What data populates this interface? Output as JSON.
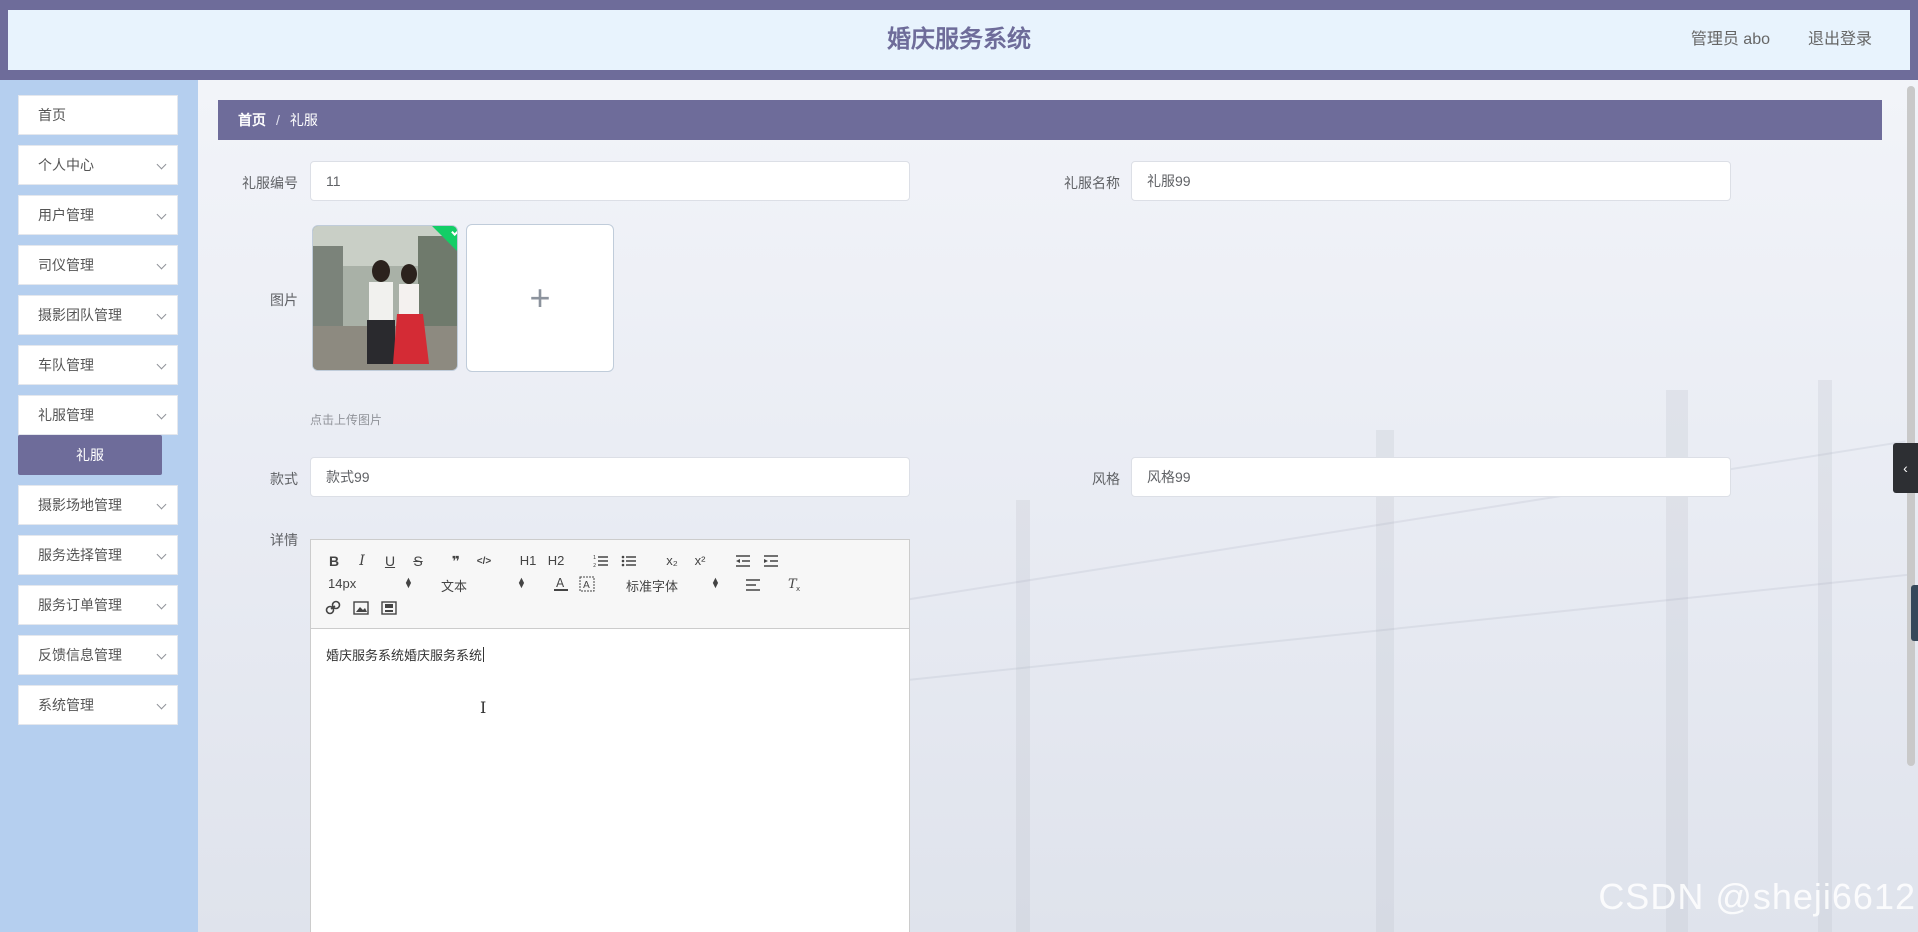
{
  "header": {
    "title": "婚庆服务系统",
    "user": "管理员 abo",
    "logout": "退出登录"
  },
  "sidebar": {
    "items": [
      {
        "label": "首页"
      },
      {
        "label": "个人中心"
      },
      {
        "label": "用户管理"
      },
      {
        "label": "司仪管理"
      },
      {
        "label": "摄影团队管理"
      },
      {
        "label": "车队管理"
      },
      {
        "label": "礼服管理"
      },
      {
        "label": "摄影场地管理"
      },
      {
        "label": "服务选择管理"
      },
      {
        "label": "服务订单管理"
      },
      {
        "label": "反馈信息管理"
      },
      {
        "label": "系统管理"
      }
    ],
    "active_sub": "礼服"
  },
  "breadcrumb": {
    "home": "首页",
    "sep": "/",
    "current": "礼服"
  },
  "form": {
    "code_label": "礼服编号",
    "code_value": "11",
    "name_label": "礼服名称",
    "name_value": "礼服99",
    "image_label": "图片",
    "upload_tip": "点击上传图片",
    "style_label": "款式",
    "style_value": "款式99",
    "genre_label": "风格",
    "genre_value": "风格99",
    "detail_label": "详情"
  },
  "editor": {
    "toolbar": {
      "bold": "B",
      "italic": "I",
      "underline": "U",
      "strike": "S",
      "quote": "❞",
      "code": "</>",
      "h1": "H1",
      "h2": "H2",
      "sub": "x₂",
      "sup": "x²",
      "size": "14px",
      "text": "文本",
      "font": "标准字体"
    },
    "content": "婚庆服务系统婚庆服务系统"
  },
  "watermark": "CSDN @sheji6612",
  "colors": {
    "accent": "#6e6c9a",
    "sidebar_bg": "#b5cfef",
    "header_bg": "#e8f3fd",
    "success": "#13ce66"
  }
}
